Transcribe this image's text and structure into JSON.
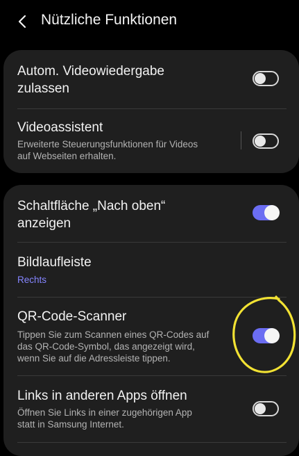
{
  "header": {
    "title": "Nützliche Funktionen",
    "back_icon": "chevron-left-icon"
  },
  "sections": [
    {
      "items": [
        {
          "label_lines": [
            "Autom. Videowiedergabe",
            "zulassen"
          ],
          "toggle": "off"
        },
        {
          "label_lines": [
            "Videoassistent"
          ],
          "subtitle_lines": [
            "Erweiterte Steuerungsfunktionen für Videos",
            "auf Webseiten erhalten."
          ],
          "toggle": "off"
        }
      ]
    },
    {
      "items": [
        {
          "label_lines": [
            "Schaltfläche „Nach oben“",
            "anzeigen"
          ],
          "toggle": "on"
        },
        {
          "label_lines": [
            "Bildlaufleiste"
          ],
          "value": "Rechts"
        },
        {
          "label_lines": [
            "QR-Code-Scanner"
          ],
          "subtitle_lines": [
            "Tippen Sie zum Scannen eines QR-Codes auf",
            "das QR-Code-Symbol, das angezeigt wird,",
            "wenn Sie auf die Adressleiste tippen."
          ],
          "toggle": "on"
        },
        {
          "label_lines": [
            "Links in anderen Apps öffnen"
          ],
          "subtitle_lines": [
            "Öffnen Sie Links in einer zugehörigen App",
            "statt in Samsung Internet."
          ],
          "toggle": "off"
        }
      ]
    }
  ],
  "colors": {
    "background": "#000000",
    "card": "#1f1f1f",
    "accent": "#6b6df2",
    "link": "#8585ff",
    "annotation": "#f2e233"
  }
}
